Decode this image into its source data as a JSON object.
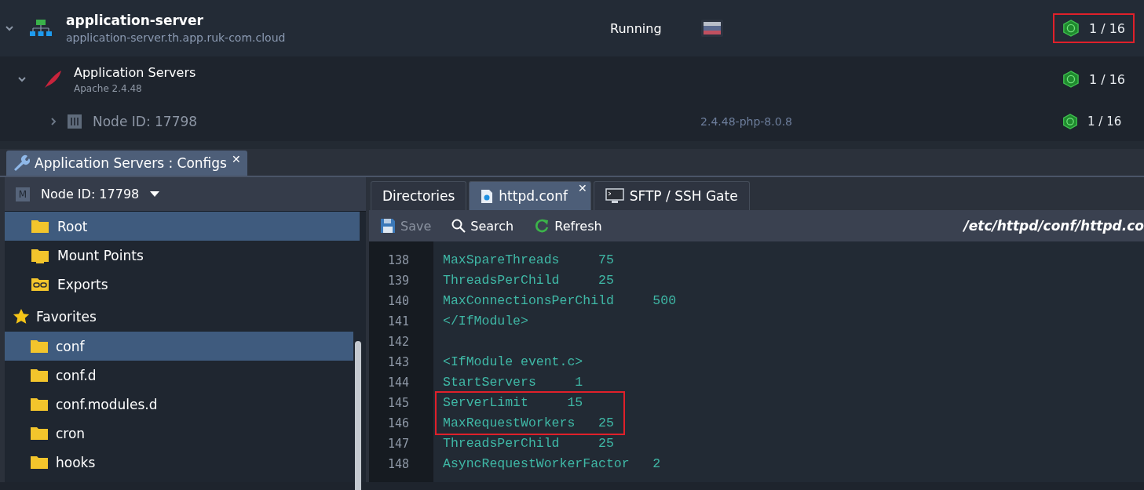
{
  "environment": {
    "name": "application-server",
    "domain": "application-server.th.app.ruk-com.cloud",
    "status": "Running",
    "expanded": true,
    "counter": "1 / 16",
    "highlighted": true
  },
  "layers": [
    {
      "name": "Application Servers",
      "version": "Apache 2.4.48",
      "counter": "1 / 16",
      "expanded": true,
      "nodes": [
        {
          "name": "Node ID: 17798",
          "tag": "2.4.48-php-8.0.8",
          "counter": "1 / 16",
          "expanded": false
        }
      ]
    }
  ],
  "panel_tab": {
    "label": "Application Servers : Configs",
    "close": "✕"
  },
  "node_selector": {
    "badge": "M",
    "label": "Node ID: 17798"
  },
  "locations": [
    {
      "label": "Root",
      "kind": "folder",
      "selected": true
    },
    {
      "label": "Mount Points",
      "kind": "mount",
      "selected": false
    },
    {
      "label": "Exports",
      "kind": "export",
      "selected": false
    }
  ],
  "favorites": {
    "label": "Favorites",
    "items": [
      {
        "label": "conf",
        "selected": true
      },
      {
        "label": "conf.d",
        "selected": false
      },
      {
        "label": "conf.modules.d",
        "selected": false
      },
      {
        "label": "cron",
        "selected": false
      },
      {
        "label": "hooks",
        "selected": false
      }
    ]
  },
  "editor_tabs": [
    {
      "label": "Directories",
      "kind": "plain",
      "selected": false
    },
    {
      "label": "httpd.conf",
      "kind": "file",
      "selected": true,
      "close": "✕"
    },
    {
      "label": "SFTP / SSH Gate",
      "kind": "terminal",
      "selected": false
    }
  ],
  "toolbar": {
    "buttons": [
      {
        "label": "Save",
        "kind": "save",
        "disabled": true
      },
      {
        "label": "Search",
        "kind": "search",
        "disabled": false
      },
      {
        "label": "Refresh",
        "kind": "refresh",
        "disabled": false
      }
    ],
    "path": "/etc/httpd/conf/httpd.co"
  },
  "code_blocks": [
    {
      "highlighted": false,
      "lines": [
        {
          "number": "138",
          "text": "MaxSpareThreads     75"
        },
        {
          "number": "139",
          "text": "ThreadsPerChild     25"
        },
        {
          "number": "140",
          "text": "MaxConnectionsPerChild     500"
        },
        {
          "number": "141",
          "text": "</IfModule>"
        },
        {
          "number": "142"
        },
        {
          "number": "143",
          "text": "<IfModule event.c>"
        },
        {
          "number": "144",
          "text": "StartServers     1"
        }
      ]
    },
    {
      "highlighted": true,
      "lines": [
        {
          "number": "145",
          "text": "ServerLimit     15"
        },
        {
          "number": "146",
          "text": "MaxRequestWorkers   25"
        }
      ]
    },
    {
      "highlighted": false,
      "lines": [
        {
          "number": "147",
          "text": "ThreadsPerChild     25"
        },
        {
          "number": "148",
          "text": "AsyncRequestWorkerFactor   2"
        }
      ]
    }
  ]
}
